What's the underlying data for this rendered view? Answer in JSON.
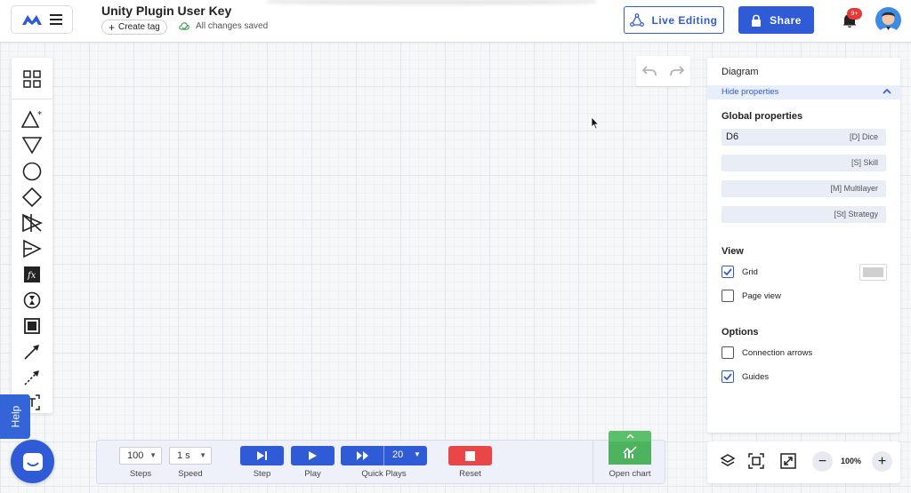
{
  "header": {
    "title": "Unity Plugin User Key",
    "create_tag": "Create tag",
    "saved_status": "All changes saved",
    "live_editing": "Live Editing",
    "share": "Share",
    "notification_count": "9+"
  },
  "left_toolbar": {
    "tools": [
      "grid-icon",
      "source-triangle-icon",
      "drain-triangle-icon",
      "pool-circle-icon",
      "gate-diamond-icon",
      "converter-icon",
      "trader-icon",
      "register-fx-icon",
      "delay-icon",
      "end-condition-icon",
      "resource-connection-icon",
      "state-connection-icon",
      "text-icon"
    ]
  },
  "help": {
    "label": "Help"
  },
  "panel": {
    "title": "Diagram",
    "hide_properties": "Hide properties",
    "global_title": "Global properties",
    "global_rows": [
      {
        "value": "D6",
        "label": "[D] Dice"
      },
      {
        "value": "",
        "label": "[S] Skill"
      },
      {
        "value": "",
        "label": "[M] Multilayer"
      },
      {
        "value": "",
        "label": "[St] Strategy"
      }
    ],
    "view_title": "View",
    "grid_label": "Grid",
    "page_view_label": "Page view",
    "options_title": "Options",
    "connection_arrows_label": "Connection arrows",
    "guides_label": "Guides",
    "grid_checked": true,
    "page_view_checked": false,
    "connection_arrows_checked": false,
    "guides_checked": true,
    "grid_color": "#d0d0d0"
  },
  "zoom": {
    "value": "100%",
    "minus": "−",
    "plus": "+"
  },
  "bottom": {
    "steps_value": "100",
    "steps_label": "Steps",
    "speed_value": "1 s",
    "speed_label": "Speed",
    "step_label": "Step",
    "play_label": "Play",
    "quick_plays_value": "20",
    "quick_plays_label": "Quick Plays",
    "reset_label": "Reset",
    "open_chart_label": "Open chart"
  },
  "colors": {
    "primary": "#2f5bd6",
    "reset": "#e94747",
    "chart": "#4db35e",
    "badge": "#e53935"
  }
}
